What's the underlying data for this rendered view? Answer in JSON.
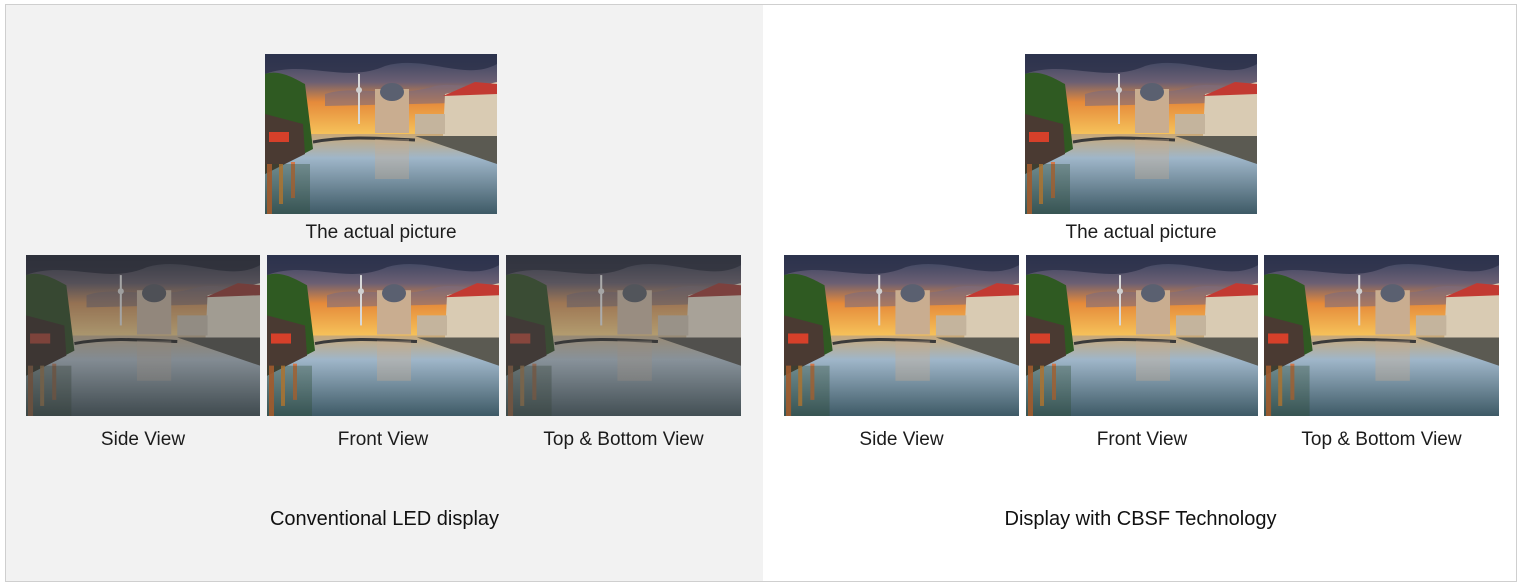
{
  "left_panel": {
    "heading": "Conventional LED display",
    "actual_caption": "The actual picture",
    "views": [
      {
        "label": "Side View",
        "quality": "degraded"
      },
      {
        "label": "Front View",
        "quality": "full"
      },
      {
        "label": "Top & Bottom View",
        "quality": "degraded"
      }
    ]
  },
  "right_panel": {
    "heading": "Display with CBSF Technology",
    "actual_caption": "The actual picture",
    "views": [
      {
        "label": "Side View",
        "quality": "full"
      },
      {
        "label": "Front View",
        "quality": "full"
      },
      {
        "label": "Top & Bottom View",
        "quality": "full"
      }
    ]
  },
  "colors": {
    "left_background": "#f2f2f2",
    "right_background": "#ffffff",
    "sky_top": "#3b4a6b",
    "sunset": "#f2a03a",
    "water": "#8aa8c0"
  }
}
